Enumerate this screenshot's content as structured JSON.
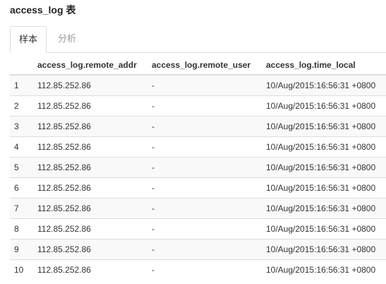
{
  "header": {
    "title": "access_log 表"
  },
  "tabs": [
    {
      "label": "样本",
      "active": true
    },
    {
      "label": "分析",
      "active": false
    }
  ],
  "table": {
    "columns": [
      "",
      "access_log.remote_addr",
      "access_log.remote_user",
      "access_log.time_local"
    ],
    "rows": [
      [
        "1",
        "112.85.252.86",
        "-",
        "10/Aug/2015:16:56:31 +0800"
      ],
      [
        "2",
        "112.85.252.86",
        "-",
        "10/Aug/2015:16:56:31 +0800"
      ],
      [
        "3",
        "112.85.252.86",
        "-",
        "10/Aug/2015:16:56:31 +0800"
      ],
      [
        "4",
        "112.85.252.86",
        "-",
        "10/Aug/2015:16:56:31 +0800"
      ],
      [
        "5",
        "112.85.252.86",
        "-",
        "10/Aug/2015:16:56:31 +0800"
      ],
      [
        "6",
        "112.85.252.86",
        "-",
        "10/Aug/2015:16:56:31 +0800"
      ],
      [
        "7",
        "112.85.252.86",
        "-",
        "10/Aug/2015:16:56:31 +0800"
      ],
      [
        "8",
        "112.85.252.86",
        "-",
        "10/Aug/2015:16:56:31 +0800"
      ],
      [
        "9",
        "112.85.252.86",
        "-",
        "10/Aug/2015:16:56:31 +0800"
      ],
      [
        "10",
        "112.85.252.86",
        "-",
        "10/Aug/2015:16:56:31 +0800"
      ]
    ]
  },
  "colors": {
    "border": "#dddddd",
    "stripe": "#f9f9f9",
    "inactive_tab": "#9a9a9a",
    "text": "#333333"
  }
}
